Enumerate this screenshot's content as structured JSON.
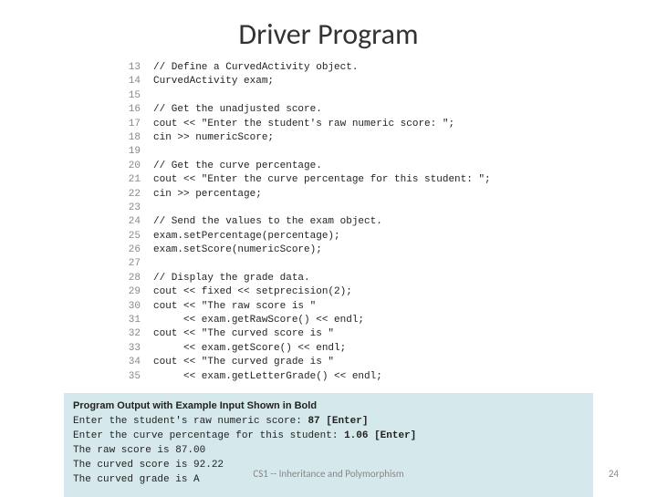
{
  "title": "Driver Program",
  "code": [
    {
      "n": "13",
      "t": "// Define a CurvedActivity object."
    },
    {
      "n": "14",
      "t": "CurvedActivity exam;"
    },
    {
      "n": "15",
      "t": ""
    },
    {
      "n": "16",
      "t": "// Get the unadjusted score."
    },
    {
      "n": "17",
      "t": "cout << \"Enter the student's raw numeric score: \";"
    },
    {
      "n": "18",
      "t": "cin >> numericScore;"
    },
    {
      "n": "19",
      "t": ""
    },
    {
      "n": "20",
      "t": "// Get the curve percentage."
    },
    {
      "n": "21",
      "t": "cout << \"Enter the curve percentage for this student: \";"
    },
    {
      "n": "22",
      "t": "cin >> percentage;"
    },
    {
      "n": "23",
      "t": ""
    },
    {
      "n": "24",
      "t": "// Send the values to the exam object."
    },
    {
      "n": "25",
      "t": "exam.setPercentage(percentage);"
    },
    {
      "n": "26",
      "t": "exam.setScore(numericScore);"
    },
    {
      "n": "27",
      "t": ""
    },
    {
      "n": "28",
      "t": "// Display the grade data."
    },
    {
      "n": "29",
      "t": "cout << fixed << setprecision(2);"
    },
    {
      "n": "30",
      "t": "cout << \"The raw score is \""
    },
    {
      "n": "31",
      "t": "     << exam.getRawScore() << endl;"
    },
    {
      "n": "32",
      "t": "cout << \"The curved score is \""
    },
    {
      "n": "33",
      "t": "     << exam.getScore() << endl;"
    },
    {
      "n": "34",
      "t": "cout << \"The curved grade is \""
    },
    {
      "n": "35",
      "t": "     << exam.getLetterGrade() << endl;"
    }
  ],
  "output": {
    "heading": "Program Output with Example Input Shown in Bold",
    "lines": [
      {
        "prompt": "Enter the student's raw numeric score: ",
        "input": "87 [Enter]"
      },
      {
        "prompt": "Enter the curve percentage for this student: ",
        "input": "1.06 [Enter]"
      },
      {
        "prompt": "The raw score is 87.00",
        "input": ""
      },
      {
        "prompt": "The curved score is 92.22",
        "input": ""
      },
      {
        "prompt": "The curved grade is A",
        "input": ""
      }
    ]
  },
  "footer": "CS1 -- Inheritance and Polymorphism",
  "page": "24"
}
